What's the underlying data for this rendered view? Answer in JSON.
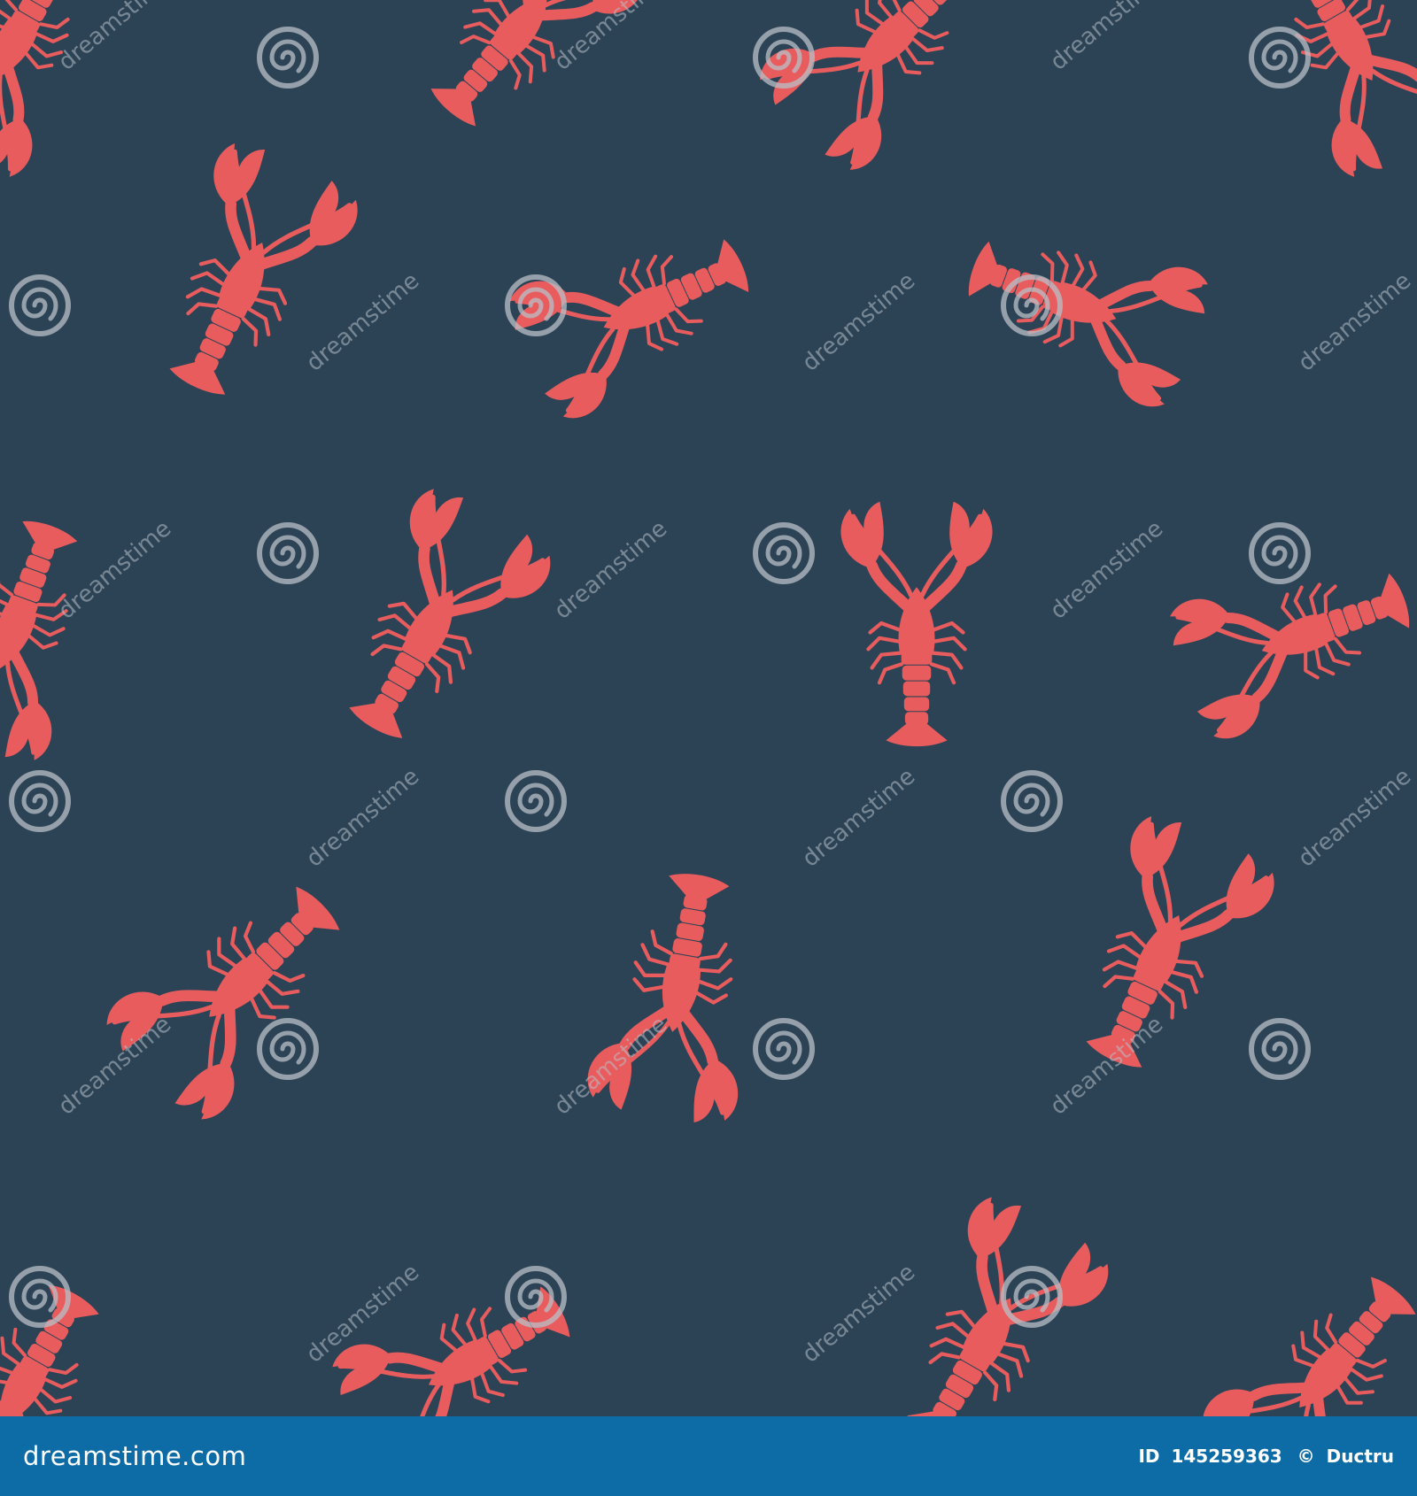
{
  "image": {
    "subject": "lobster",
    "colors": {
      "background": "#2c4356",
      "lobster": "#e85c5d",
      "watermark": "#b8c0c8",
      "footer": "#0d6ca6",
      "footer_text": "#ffffff"
    }
  },
  "watermark": {
    "word": "dreamstime",
    "icon": "swirl-logo-icon"
  },
  "footer": {
    "site": "dreamstime.com",
    "id_label": "ID",
    "id_value": "145259363",
    "copyright": "©",
    "author": "Ductru"
  }
}
